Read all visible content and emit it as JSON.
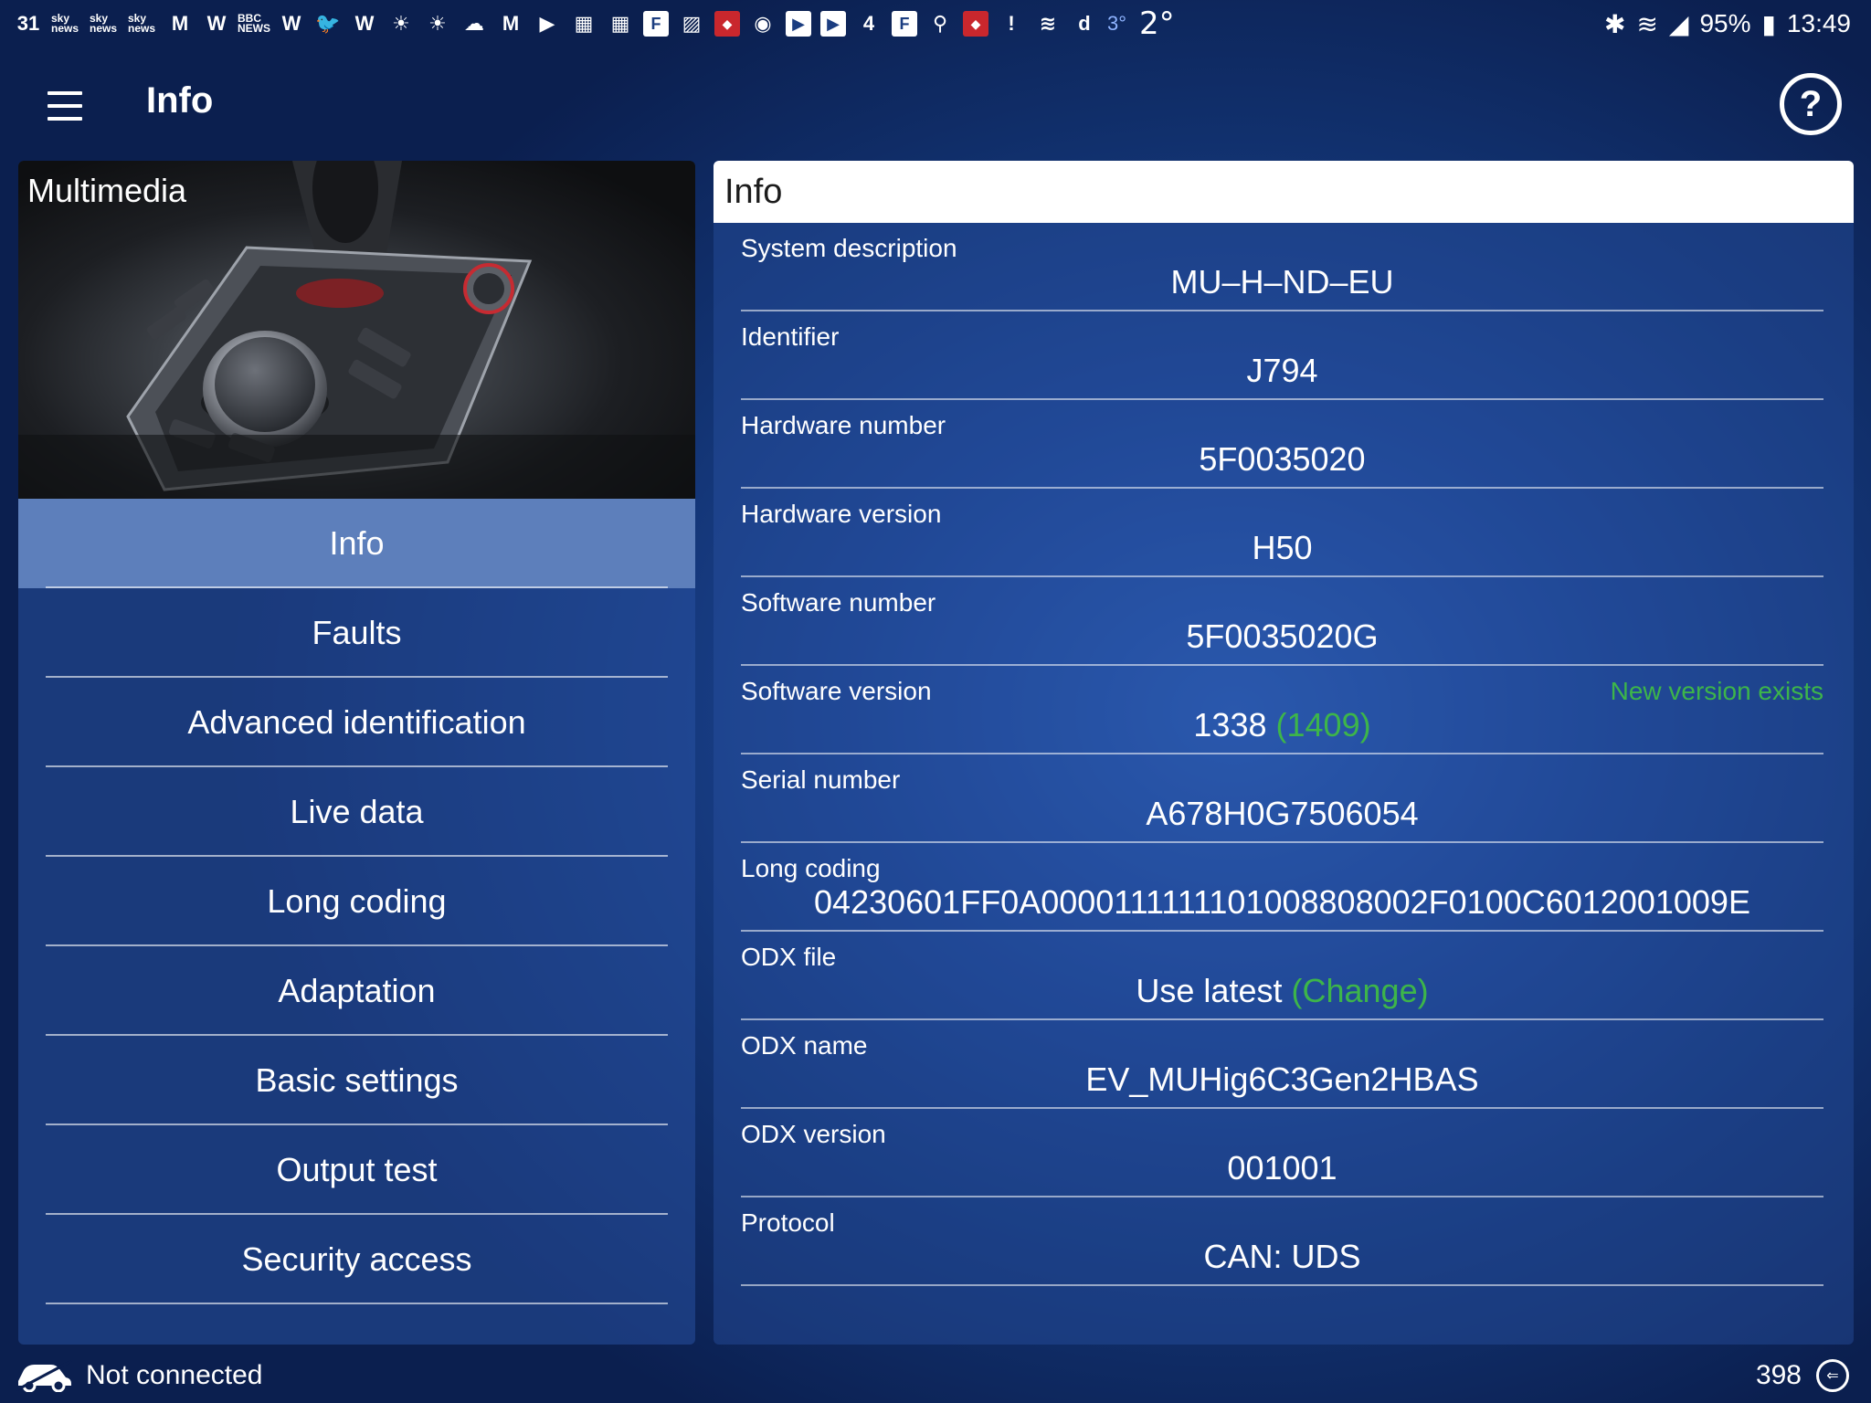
{
  "status_bar": {
    "notification_icons": [
      {
        "name": "calendar-icon",
        "glyph": "31",
        "style": "plain"
      },
      {
        "name": "sky-news-icon",
        "glyph": "sky news",
        "style": "small"
      },
      {
        "name": "sky-news-icon",
        "glyph": "sky news",
        "style": "small"
      },
      {
        "name": "sky-news-icon",
        "glyph": "sky news",
        "style": "small"
      },
      {
        "name": "gmail-icon",
        "glyph": "M",
        "style": "plain"
      },
      {
        "name": "w-icon",
        "glyph": "W",
        "style": "plain"
      },
      {
        "name": "bbc-news-icon",
        "glyph": "BBC NEWS",
        "style": "small"
      },
      {
        "name": "w-icon",
        "glyph": "W",
        "style": "plain"
      },
      {
        "name": "twitter-icon",
        "glyph": "🐦",
        "style": "plain"
      },
      {
        "name": "w-icon",
        "glyph": "W",
        "style": "plain"
      },
      {
        "name": "sun-icon",
        "glyph": "☀",
        "style": "plain"
      },
      {
        "name": "sun-icon",
        "glyph": "☀",
        "style": "plain"
      },
      {
        "name": "cloud-icon",
        "glyph": "☁",
        "style": "plain"
      },
      {
        "name": "gmail-icon",
        "glyph": "M",
        "style": "plain"
      },
      {
        "name": "play-store-icon",
        "glyph": "▶",
        "style": "plain"
      },
      {
        "name": "calendar-icon",
        "glyph": "▦",
        "style": "plain"
      },
      {
        "name": "calendar-icon",
        "glyph": "▦",
        "style": "plain"
      },
      {
        "name": "flipboard-icon",
        "glyph": "F",
        "style": "box"
      },
      {
        "name": "photos-icon",
        "glyph": "▨",
        "style": "plain"
      },
      {
        "name": "app-red-icon",
        "glyph": "◆",
        "style": "red"
      },
      {
        "name": "compass-icon",
        "glyph": "◉",
        "style": "plain"
      },
      {
        "name": "youtube-icon",
        "glyph": "▶",
        "style": "box"
      },
      {
        "name": "youtube-icon",
        "glyph": "▶",
        "style": "box"
      },
      {
        "name": "channel4-icon",
        "glyph": "4",
        "style": "plain"
      },
      {
        "name": "flipboard-icon",
        "glyph": "F",
        "style": "box"
      },
      {
        "name": "location-icon",
        "glyph": "⚲",
        "style": "plain"
      },
      {
        "name": "app-red-icon",
        "glyph": "◆",
        "style": "red"
      },
      {
        "name": "message-alert-icon",
        "glyph": "!",
        "style": "plain"
      },
      {
        "name": "layers-icon",
        "glyph": "≋",
        "style": "plain"
      },
      {
        "name": "document-icon",
        "glyph": "d",
        "style": "plain"
      }
    ],
    "small_temperature": "3°",
    "temperature": "2°",
    "battery": "95%",
    "time": "13:49"
  },
  "app_bar": {
    "title": "Info"
  },
  "left_panel": {
    "title": "Multimedia",
    "nav_items": [
      {
        "label": "Info",
        "active": true
      },
      {
        "label": "Faults",
        "active": false
      },
      {
        "label": "Advanced identification",
        "active": false
      },
      {
        "label": "Live data",
        "active": false
      },
      {
        "label": "Long coding",
        "active": false
      },
      {
        "label": "Adaptation",
        "active": false
      },
      {
        "label": "Basic settings",
        "active": false
      },
      {
        "label": "Output test",
        "active": false
      },
      {
        "label": "Security access",
        "active": false
      }
    ]
  },
  "info_panel": {
    "header": "Info",
    "fields": [
      {
        "label": "System description",
        "value": "MU–H–ND–EU"
      },
      {
        "label": "Identifier",
        "value": "J794"
      },
      {
        "label": "Hardware number",
        "value": "5F0035020"
      },
      {
        "label": "Hardware version",
        "value": "H50"
      },
      {
        "label": "Software number",
        "value": "5F0035020G"
      },
      {
        "label": "Software version",
        "value": "1338",
        "value_extra": "(1409)",
        "note": "New version exists"
      },
      {
        "label": "Serial number",
        "value": "A678H0G7506054"
      },
      {
        "label": "Long coding",
        "value": "04230601FF0A0000111111101008808002F0100C6012001009E"
      },
      {
        "label": "ODX file",
        "value": "Use latest",
        "value_extra": "(Change)"
      },
      {
        "label": "ODX name",
        "value": "EV_MUHig6C3Gen2HBAS"
      },
      {
        "label": "ODX version",
        "value": "001001"
      },
      {
        "label": "Protocol",
        "value": "CAN: UDS"
      }
    ]
  },
  "bottom_bar": {
    "connection_status": "Not connected",
    "counter": "398"
  },
  "colors": {
    "accent_green": "#3db54a",
    "active_nav": "#5d7fbb",
    "background": "#1d4593"
  }
}
